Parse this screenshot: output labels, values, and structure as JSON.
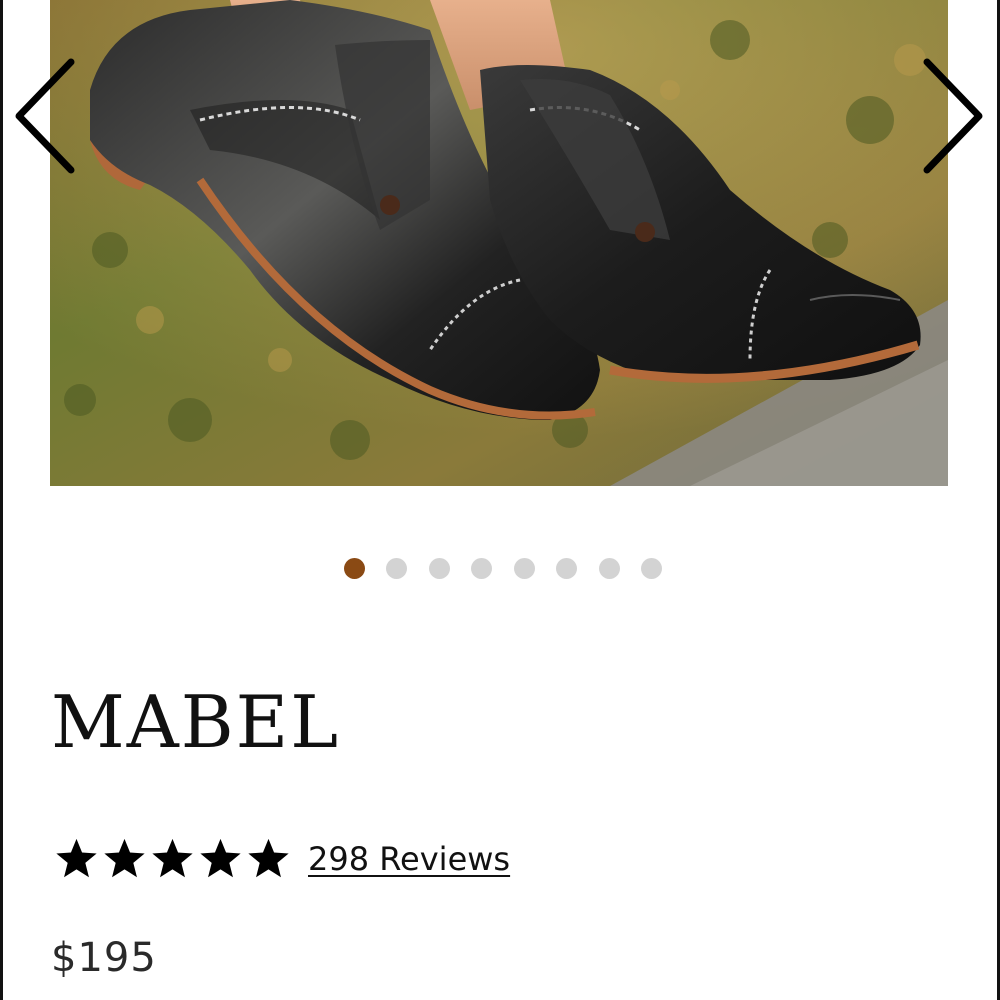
{
  "gallery": {
    "image_subject": "black leather cap-toe oxford shoes on grass",
    "prev_icon": "chevron-left-icon",
    "next_icon": "chevron-right-icon",
    "slide_count": 8,
    "active_slide": 1,
    "colors": {
      "active_dot": "#8a4a14",
      "inactive_dot": "#d3d3d3"
    }
  },
  "product": {
    "name": "MABEL",
    "rating": {
      "stars": 5,
      "max": 5,
      "star_icon": "star-icon"
    },
    "reviews_label": "298 Reviews",
    "price": "$195"
  }
}
